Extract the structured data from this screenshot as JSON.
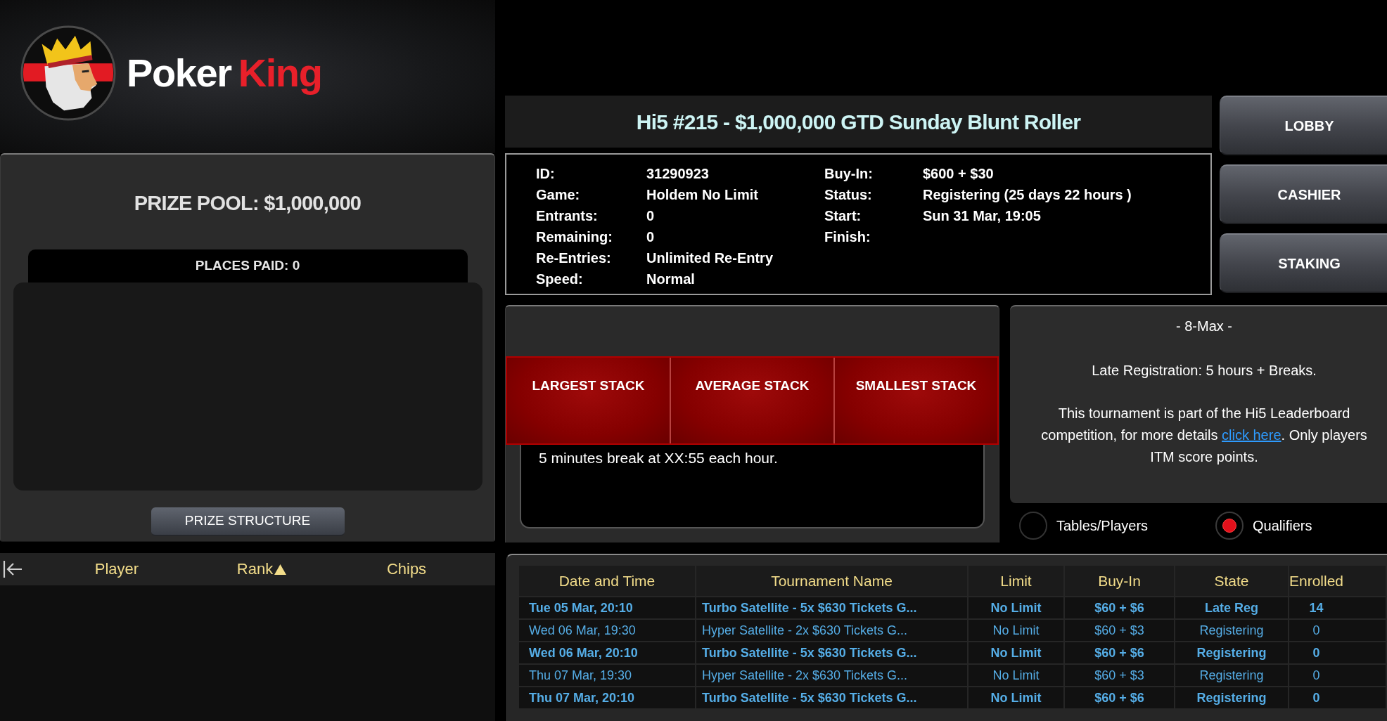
{
  "logo": {
    "text": "Poker",
    "accent_text": "King"
  },
  "prize_panel": {
    "title": "PRIZE POOL: $1,000,000",
    "places_paid": "PLACES PAID: 0",
    "button": "PRIZE STRUCTURE"
  },
  "players_table": {
    "columns": [
      {
        "label": "Player",
        "sorted": false
      },
      {
        "label": "Rank",
        "sorted": true
      },
      {
        "label": "Chips",
        "sorted": false
      }
    ]
  },
  "tournament": {
    "title": "Hi5 #215 - $1,000,000 GTD Sunday Blunt Roller",
    "details_left": [
      {
        "label": "ID:",
        "value": "31290923"
      },
      {
        "label": "Game:",
        "value": "Holdem No Limit"
      },
      {
        "label": "Entrants:",
        "value": "0"
      },
      {
        "label": "Remaining:",
        "value": "0"
      },
      {
        "label": "Re-Entries:",
        "value": "Unlimited Re-Entry"
      },
      {
        "label": "Speed:",
        "value": "Normal"
      }
    ],
    "details_right": [
      {
        "label": "Buy-In:",
        "value": "$600 + $30"
      },
      {
        "label": "Status:",
        "value": "Registering (25 days 22 hours )"
      },
      {
        "label": "Start:",
        "value": "Sun 31 Mar, 19:05"
      },
      {
        "label": "Finish:"
      }
    ]
  },
  "nav_buttons": [
    "LOBBY",
    "CASHIER",
    "STAKING"
  ],
  "stacks": {
    "columns": [
      "LARGEST STACK",
      "AVERAGE STACK",
      "SMALLEST STACK"
    ],
    "note": "5 minutes break at XX:55 each hour."
  },
  "description": {
    "max_players": "- 8-Max -",
    "late_registration": "Late Registration: 5 hours + Breaks.",
    "leaderboard": {
      "before": "This tournament is part of the Hi5 Leaderboard competition, for more details ",
      "link": "click here",
      "after": ". Only players ITM score points."
    }
  },
  "view_options": [
    {
      "label": "Tables/Players",
      "selected": false
    },
    {
      "label": "Qualifiers",
      "selected": true
    }
  ],
  "qualifiers_table": {
    "columns": [
      "Date and Time",
      "Tournament Name",
      "Limit",
      "Buy-In",
      "State",
      "Enrolled"
    ],
    "rows": [
      {
        "emphasized": true,
        "cells": [
          "Tue 05 Mar, 20:10",
          "Turbo Satellite - 5x $630 Tickets G...",
          "No Limit",
          "$60 + $6",
          "Late Reg",
          "14"
        ]
      },
      {
        "emphasized": false,
        "cells": [
          "Wed 06 Mar, 19:30",
          "Hyper Satellite - 2x $630 Tickets G...",
          "No Limit",
          "$60 + $3",
          "Registering",
          "0"
        ]
      },
      {
        "emphasized": true,
        "cells": [
          "Wed 06 Mar, 20:10",
          "Turbo Satellite - 5x $630 Tickets G...",
          "No Limit",
          "$60 + $6",
          "Registering",
          "0"
        ]
      },
      {
        "emphasized": false,
        "cells": [
          "Thu 07 Mar, 19:30",
          "Hyper Satellite - 2x $630 Tickets G...",
          "No Limit",
          "$60 + $3",
          "Registering",
          "0"
        ]
      },
      {
        "emphasized": true,
        "cells": [
          "Thu 07 Mar, 20:10",
          "Turbo Satellite - 5x $630 Tickets G...",
          "No Limit",
          "$60 + $6",
          "Registering",
          "0"
        ]
      }
    ]
  }
}
